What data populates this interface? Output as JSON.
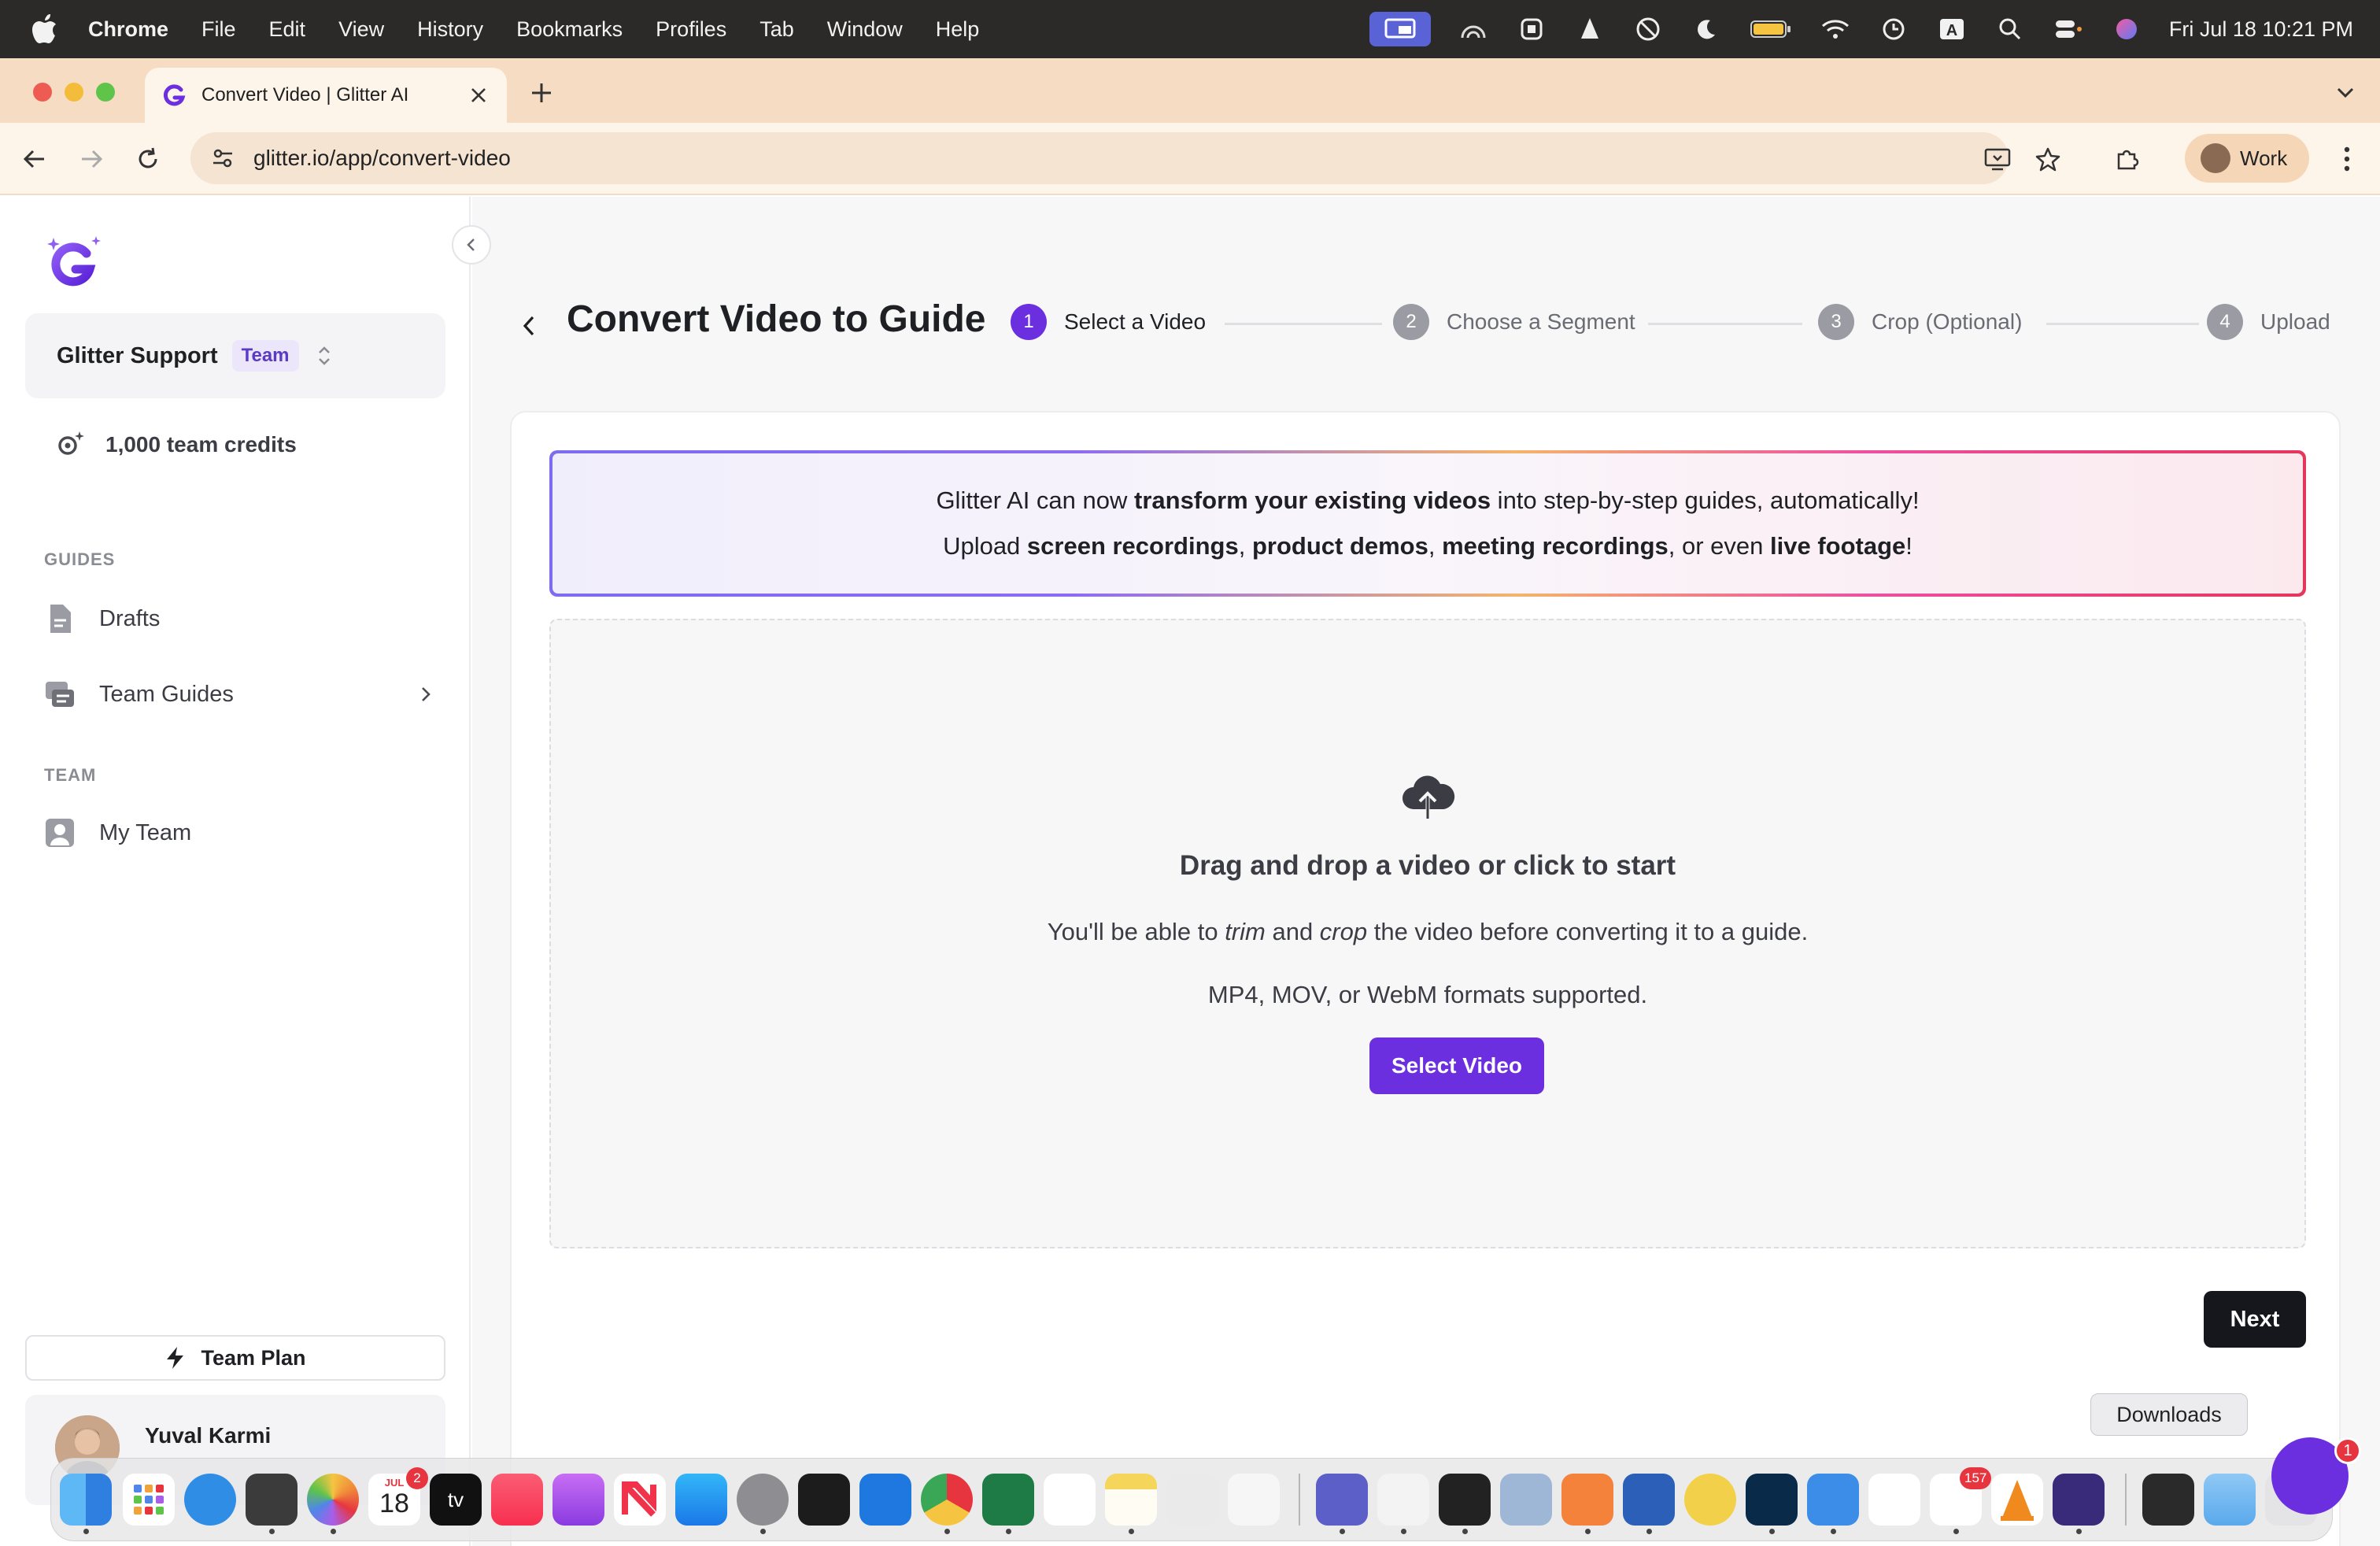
{
  "menubar": {
    "app_name": "Chrome",
    "items": [
      "File",
      "Edit",
      "View",
      "History",
      "Bookmarks",
      "Profiles",
      "Tab",
      "Window",
      "Help"
    ],
    "clock": "Fri Jul 18  10:21 PM"
  },
  "browser": {
    "tab_title": "Convert Video | Glitter AI",
    "url": "glitter.io/app/convert-video",
    "profile_label": "Work"
  },
  "sidebar": {
    "workspace_name": "Glitter Support",
    "workspace_badge": "Team",
    "credits": "1,000 team credits",
    "guides_section": "GUIDES",
    "items": [
      {
        "label": "Drafts"
      },
      {
        "label": "Team Guides"
      }
    ],
    "team_section": "TEAM",
    "team_items": [
      {
        "label": "My Team"
      }
    ],
    "plan_label": "Team Plan",
    "user_name": "Yuval Karmi"
  },
  "main": {
    "title": "Convert Video to Guide",
    "steps": [
      {
        "num": "1",
        "label": "Select a Video"
      },
      {
        "num": "2",
        "label": "Choose a Segment"
      },
      {
        "num": "3",
        "label": "Crop (Optional)"
      },
      {
        "num": "4",
        "label": "Upload"
      }
    ],
    "banner": {
      "l1_a": "Glitter AI can now ",
      "l1_b": "transform your existing videos",
      "l1_c": " into step-by-step guides, automatically!",
      "l2_a": "Upload ",
      "l2_b": "screen recordings",
      "l2_c": ", ",
      "l2_d": "product demos",
      "l2_e": ", ",
      "l2_f": "meeting recordings",
      "l2_g": ", or even ",
      "l2_h": "live footage",
      "l2_i": "!"
    },
    "dropzone": {
      "title": "Drag and drop a video or click to start",
      "sub_a": "You'll be able to ",
      "sub_b": "trim",
      "sub_c": " and ",
      "sub_d": "crop",
      "sub_e": " the video before converting it to a guide.",
      "formats": "MP4, MOV, or WebM formats supported.",
      "button": "Select Video"
    },
    "next_button": "Next"
  },
  "dock": {
    "tooltip": "Downloads",
    "calendar_month": "JUL",
    "calendar_day": "18",
    "calendar_badge": "2",
    "slack_badge": "157",
    "chat_badge": "1",
    "tv_label": "tv"
  },
  "colors": {
    "accent": "#6b2fe0",
    "menubar": "#2b2a28",
    "tabstrip": "#f6dcc2",
    "toolbar": "#fdf4ea",
    "next_button": "#16171c"
  }
}
